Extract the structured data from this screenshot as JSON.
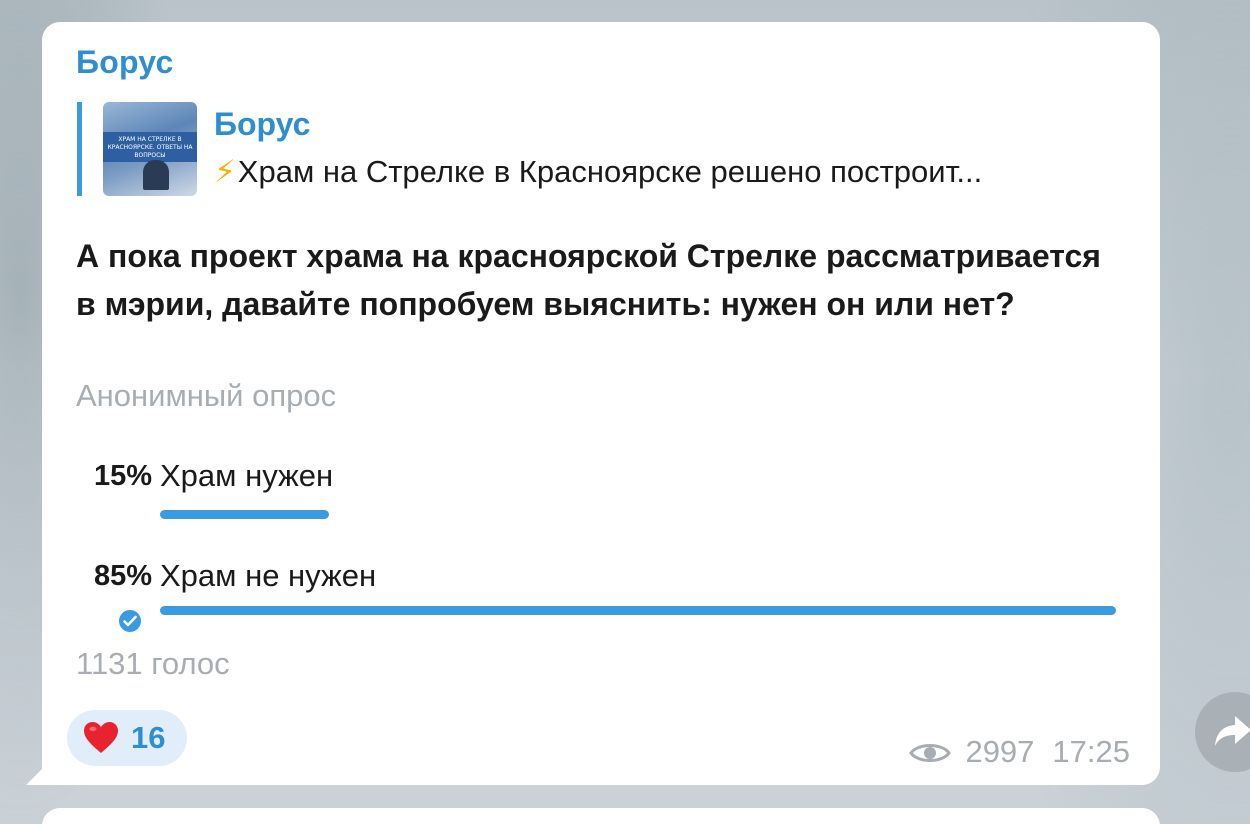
{
  "message": {
    "author": "Борус",
    "reply": {
      "author": "Борус",
      "bolt_icon": "⚡",
      "text": "Храм на Стрелке в Красноярске решено построит...",
      "thumbnail_text": "ХРАМ НА СТРЕЛКЕ В КРАСНОЯРСКЕ. ОТВЕТЫ НА ВОПРОСЫ"
    },
    "question": "А пока проект храма на красноярской Стрелке рассматривается в мэрии, давайте попробуем выяснить: нужен он или нет?",
    "poll_type": "Анонимный опрос",
    "options": [
      {
        "percent": "15%",
        "label": "Храм нужен",
        "fraction": 0.15,
        "chosen": false
      },
      {
        "percent": "85%",
        "label": "Храм не нужен",
        "fraction": 0.85,
        "chosen": true
      }
    ],
    "votes": "1131 голос",
    "reaction": {
      "icon": "heart-icon",
      "count": "16"
    },
    "views": "2997",
    "time": "17:25"
  },
  "colors": {
    "accent": "#3a9be0",
    "author": "#2f8ed0",
    "muted": "#a7adb2",
    "reaction_bg": "#e1eef9"
  }
}
